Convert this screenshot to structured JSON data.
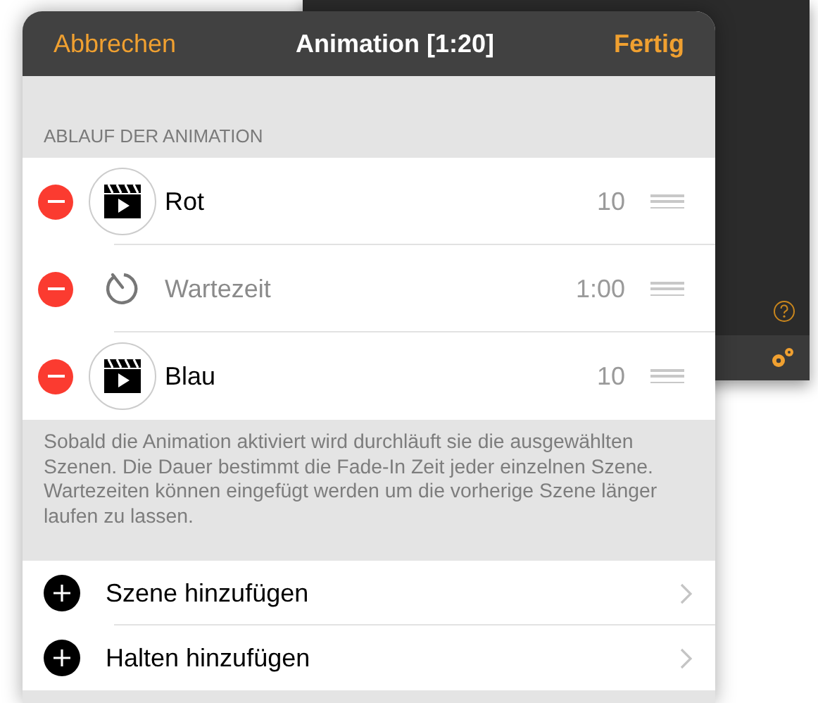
{
  "sheet": {
    "cancel": "Abbrechen",
    "title": "Animation [1:20]",
    "done": "Fertig",
    "section_header": "ABLAUF DER ANIMATION",
    "steps": [
      {
        "kind": "scene",
        "name": "Rot",
        "duration": "10"
      },
      {
        "kind": "wait",
        "name": "Wartezeit",
        "duration": "1:00"
      },
      {
        "kind": "scene",
        "name": "Blau",
        "duration": "10"
      }
    ],
    "footer": "Sobald die Animation aktiviert wird durchläuft sie die ausgewählten Szenen. Die Dauer bestimmt die Fade-In Zeit jeder einzelnen Szene. Wartezeiten können eingefügt werden um die vorherige Szene länger laufen zu lassen.",
    "actions": [
      {
        "label": "Szene hinzufügen"
      },
      {
        "label": "Halten hinzufügen"
      }
    ]
  }
}
